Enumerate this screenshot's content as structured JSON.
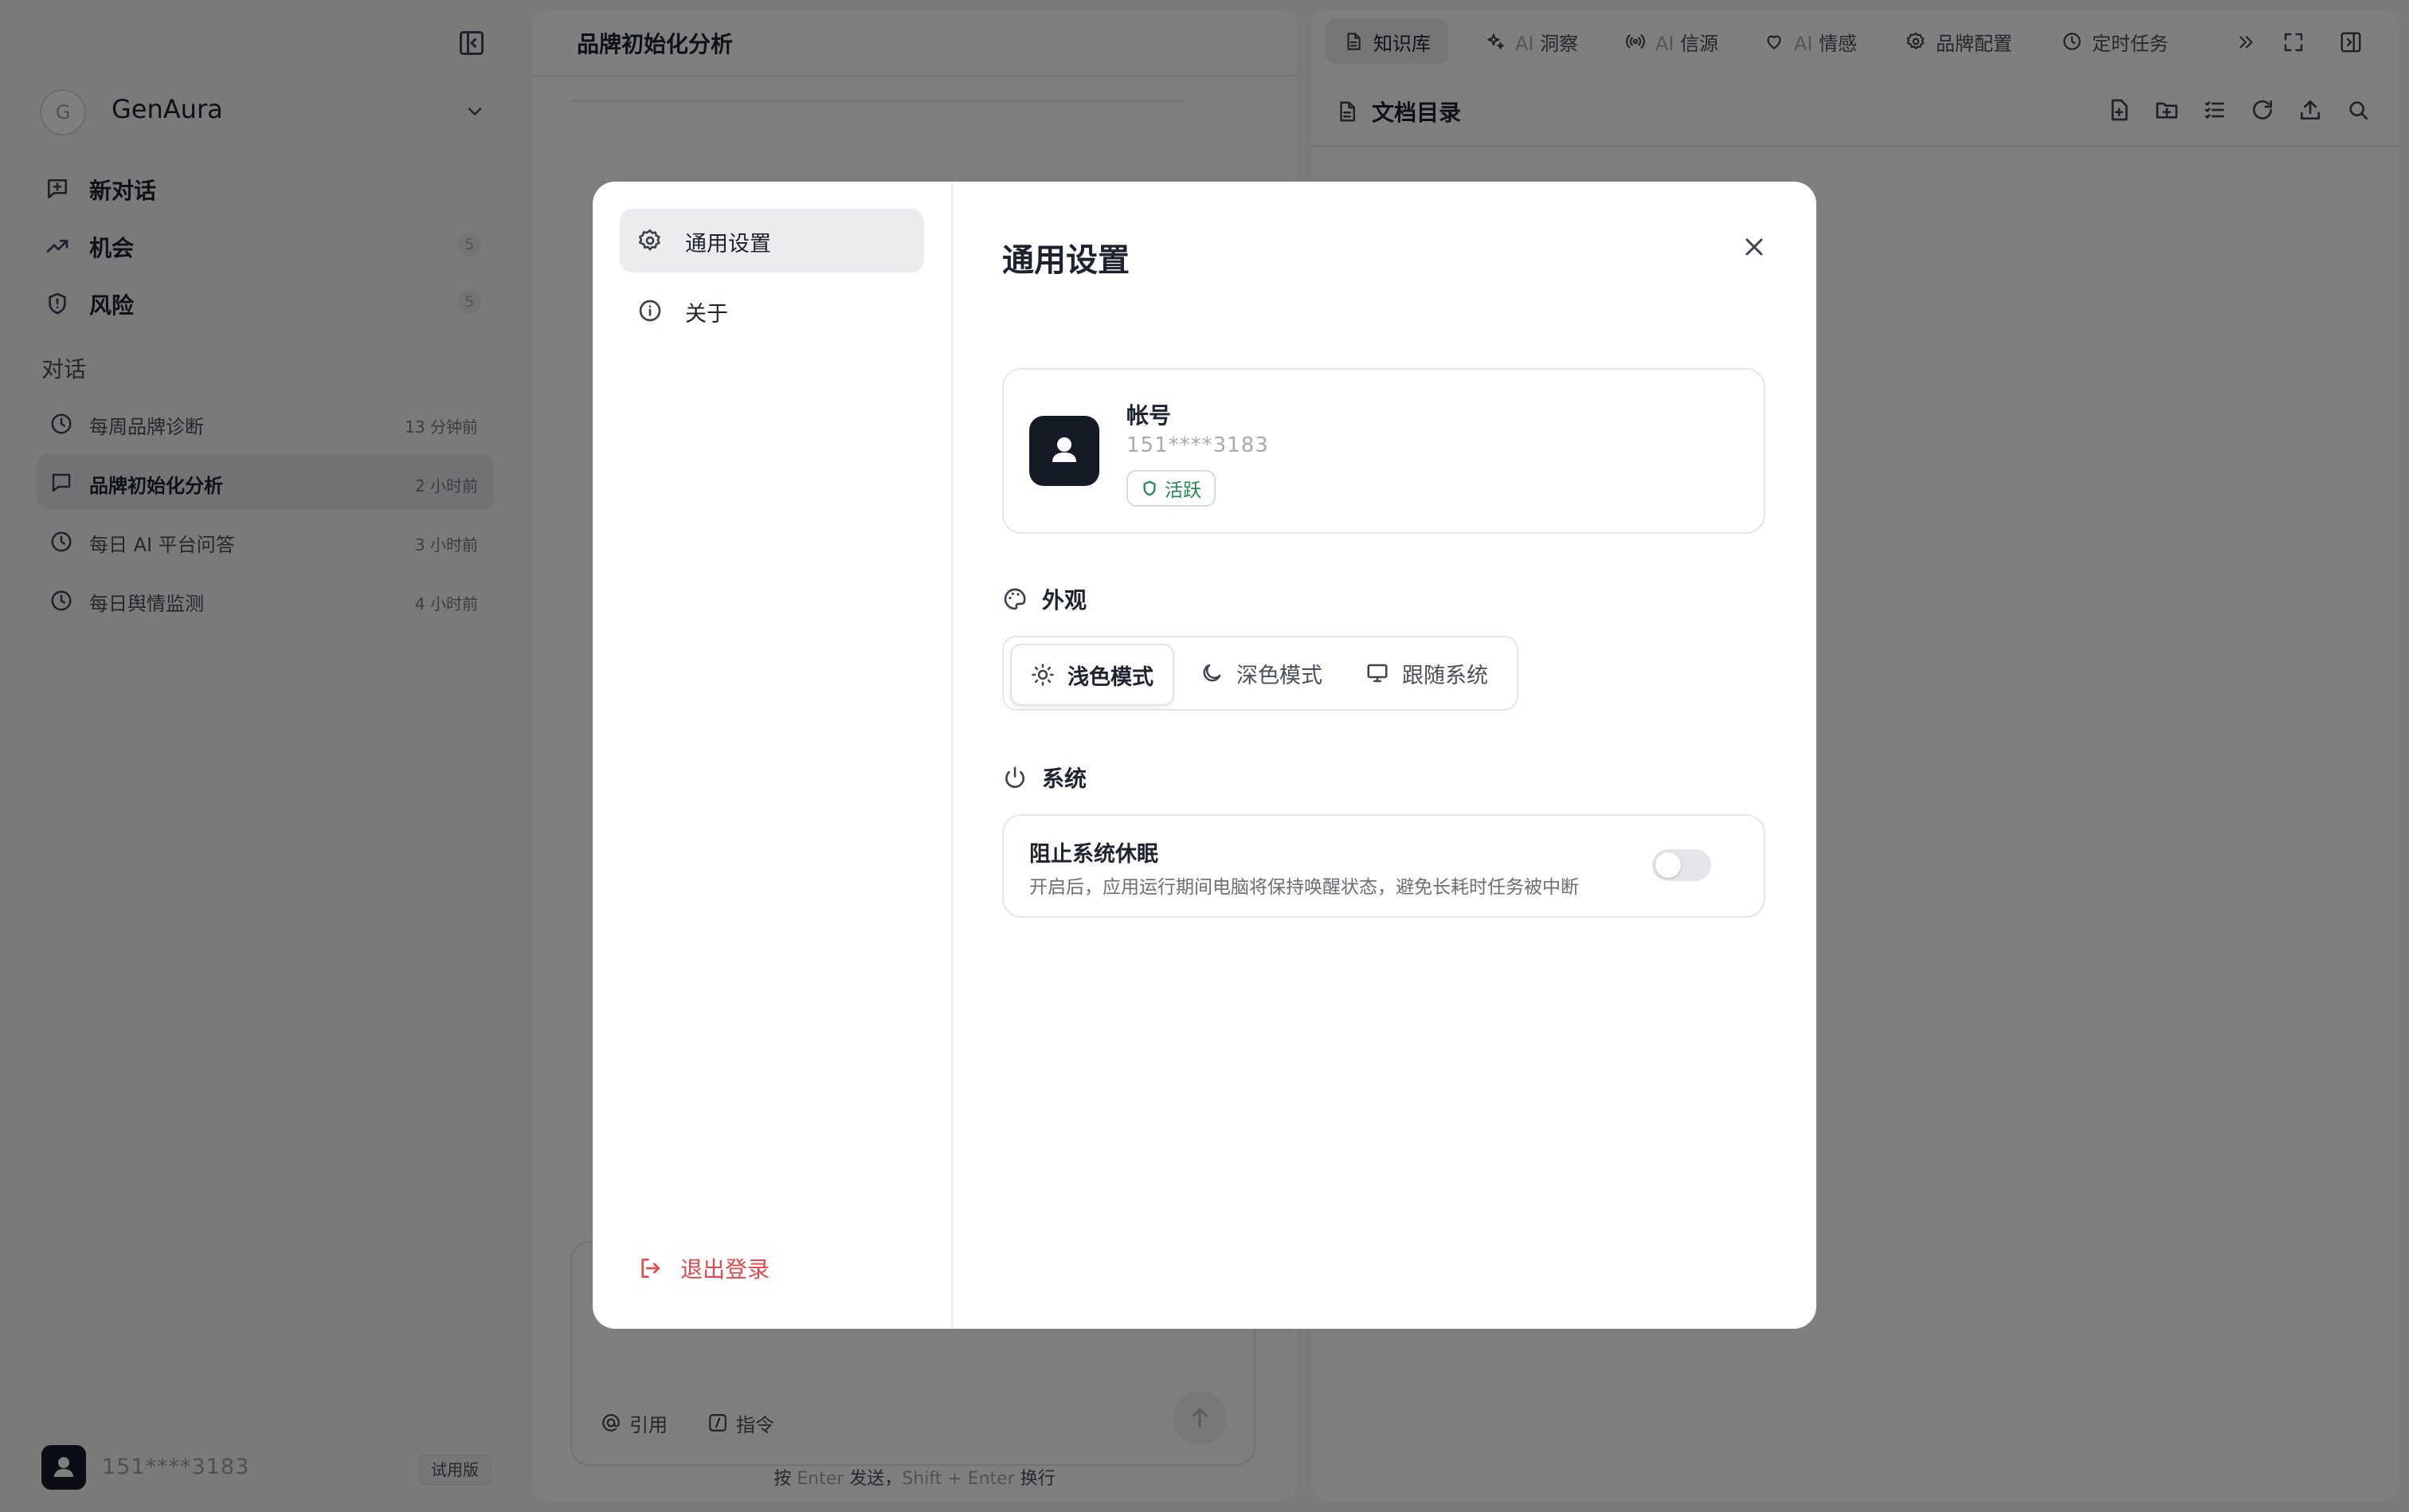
{
  "sidebar": {
    "workspace": {
      "initial": "G",
      "name": "GenAura"
    },
    "nav": [
      {
        "label": "新对话",
        "count": ""
      },
      {
        "label": "机会",
        "count": "5"
      },
      {
        "label": "风险",
        "count": "5"
      }
    ],
    "section_title": "对话",
    "conversations": [
      {
        "label": "每周品牌诊断",
        "time": "13 分钟前"
      },
      {
        "label": "品牌初始化分析",
        "time": "2 小时前"
      },
      {
        "label": "每日 AI 平台问答",
        "time": "3 小时前"
      },
      {
        "label": "每日舆情监测",
        "time": "4 小时前"
      }
    ],
    "user_phone": "151****3183",
    "plan_badge": "试用版"
  },
  "chat": {
    "title": "品牌初始化分析",
    "input": {
      "quote_label": "引用",
      "command_label": "指令"
    },
    "hint": {
      "p1": "按 ",
      "k1": "Enter",
      "p2": " 发送，",
      "k2": "Shift + Enter",
      "p3": " 换行"
    }
  },
  "right_panel": {
    "tabs": [
      {
        "label": "知识库"
      },
      {
        "prefix": "AI",
        "label": "洞察"
      },
      {
        "prefix": "AI",
        "label": "信源"
      },
      {
        "prefix": "AI",
        "label": "情感"
      },
      {
        "label": "品牌配置"
      },
      {
        "label": "定时任务"
      }
    ],
    "title": "文档目录"
  },
  "modal": {
    "nav": [
      {
        "label": "通用设置"
      },
      {
        "label": "关于"
      }
    ],
    "logout_label": "退出登录",
    "title": "通用设置",
    "account": {
      "label": "帐号",
      "phone": "151****3183",
      "status": "活跃"
    },
    "appearance": {
      "title": "外观",
      "options": [
        {
          "label": "浅色模式"
        },
        {
          "label": "深色模式"
        },
        {
          "label": "跟随系统"
        }
      ],
      "selected": "浅色模式"
    },
    "system": {
      "title": "系统",
      "prevent_sleep": {
        "name": "阻止系统休眠",
        "desc": "开启后，应用运行期间电脑将保持唤醒状态，避免长耗时任务被中断",
        "enabled": false
      }
    }
  },
  "colors": {
    "accent_dark": "#141a26",
    "danger": "#e5484d",
    "success": "#1f8a4c"
  }
}
